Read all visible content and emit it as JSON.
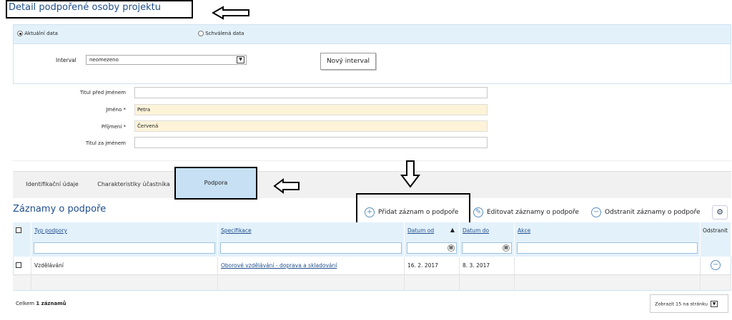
{
  "page": {
    "title": "Detail podpořené osoby projektu"
  },
  "data_mode": {
    "current_label": "Aktuální data",
    "approved_label": "Schválená data",
    "selected": "current"
  },
  "interval": {
    "label": "Interval",
    "value": "neomezeno",
    "new_button": "Nový interval"
  },
  "person": {
    "title_before_label": "Titul před jménem",
    "title_before_value": "",
    "first_name_label": "Jméno *",
    "first_name_value": "Petra",
    "last_name_label": "Příjmení *",
    "last_name_value": "Červená",
    "title_after_label": "Titul za jménem",
    "title_after_value": ""
  },
  "tabs": [
    {
      "label": "Identifikační údaje",
      "active": false
    },
    {
      "label": "Charakteristiky účastníka",
      "active": false
    },
    {
      "label": "Podpora",
      "active": true
    }
  ],
  "records": {
    "section_title": "Záznamy o podpoře",
    "add_label": "Přidat záznam o podpoře",
    "edit_label": "Editovat záznamy o podpoře",
    "remove_label": "Odstranit záznamy o podpoře",
    "columns": {
      "type": "Typ podpory",
      "spec": "Specifikace",
      "date_from": "Datum od",
      "sort_indicator": "▲",
      "date_to": "Datum do",
      "action": "Akce",
      "remove": "Odstranit"
    },
    "rows": [
      {
        "type": "Vzdělávání",
        "spec": "Oborové vzdělávání - doprava a skladování",
        "date_from": "16. 2. 2017",
        "date_to": "8. 3. 2017",
        "action": ""
      }
    ],
    "total_prefix": "Celkem",
    "total_value": "1 záznamů",
    "page_size": "Zobrazit 15 na stránku"
  },
  "colors": {
    "accent": "#1f4e8c",
    "panel_blue": "#e3f1fb",
    "active_tab": "#c7e0f3",
    "required_field": "#fdf3d9"
  }
}
